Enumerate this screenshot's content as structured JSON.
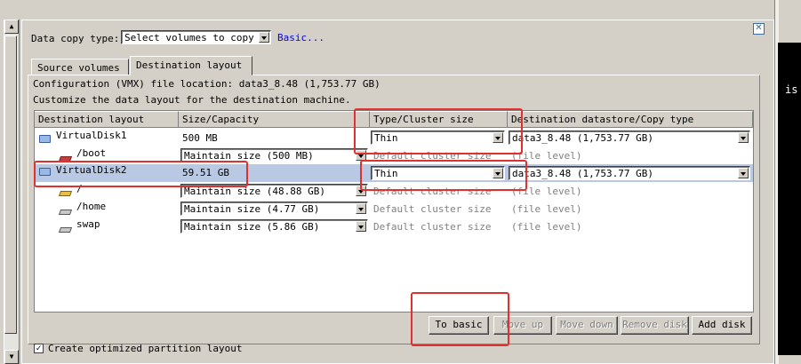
{
  "header": {
    "copy_type_label": "Data copy type:",
    "copy_type_value": "Select volumes to copy",
    "basic_link": "Basic..."
  },
  "tabs": [
    {
      "label": "Source volumes",
      "active": false
    },
    {
      "label": "Destination layout",
      "active": true
    }
  ],
  "info": {
    "config_line": "Configuration (VMX) file location: data3_8.48 (1,753.77 GB)",
    "customize_line": "Customize the data layout for the destination machine."
  },
  "table": {
    "columns": [
      "Destination layout",
      "Size/Capacity",
      "Type/Cluster size",
      "Destination datastore/Copy type"
    ],
    "rows": [
      {
        "name": "VirtualDisk1",
        "size": "500 MB",
        "type": "Thin",
        "datastore": "data3_8.48 (1,753.77 GB)"
      },
      {
        "name": "/boot",
        "size": "Maintain size (500 MB)",
        "type": "Default cluster size",
        "datastore": "(file level)"
      },
      {
        "name": "VirtualDisk2",
        "size": "59.51 GB",
        "type": "Thin",
        "datastore": "data3_8.48 (1,753.77 GB)"
      },
      {
        "name": "/",
        "size": "Maintain size (48.88 GB)",
        "type": "Default cluster size",
        "datastore": "(file level)"
      },
      {
        "name": "/home",
        "size": "Maintain size (4.77 GB)",
        "type": "Default cluster size",
        "datastore": "(file level)"
      },
      {
        "name": "swap",
        "size": "Maintain size (5.86 GB)",
        "type": "Default cluster size",
        "datastore": "(file level)"
      }
    ]
  },
  "buttons": {
    "to_basic": "To basic",
    "move_up": "Move up",
    "move_down": "Move down",
    "remove_disk": "Remove disk",
    "add_disk": "Add disk"
  },
  "footer": {
    "optimize_label": "Create optimized partition layout",
    "optimize_checked": true
  },
  "side_text": "is",
  "colors": {
    "highlight_red": "#e03030",
    "selected_row": "#b9c9e3",
    "link_blue": "#0000ff"
  }
}
